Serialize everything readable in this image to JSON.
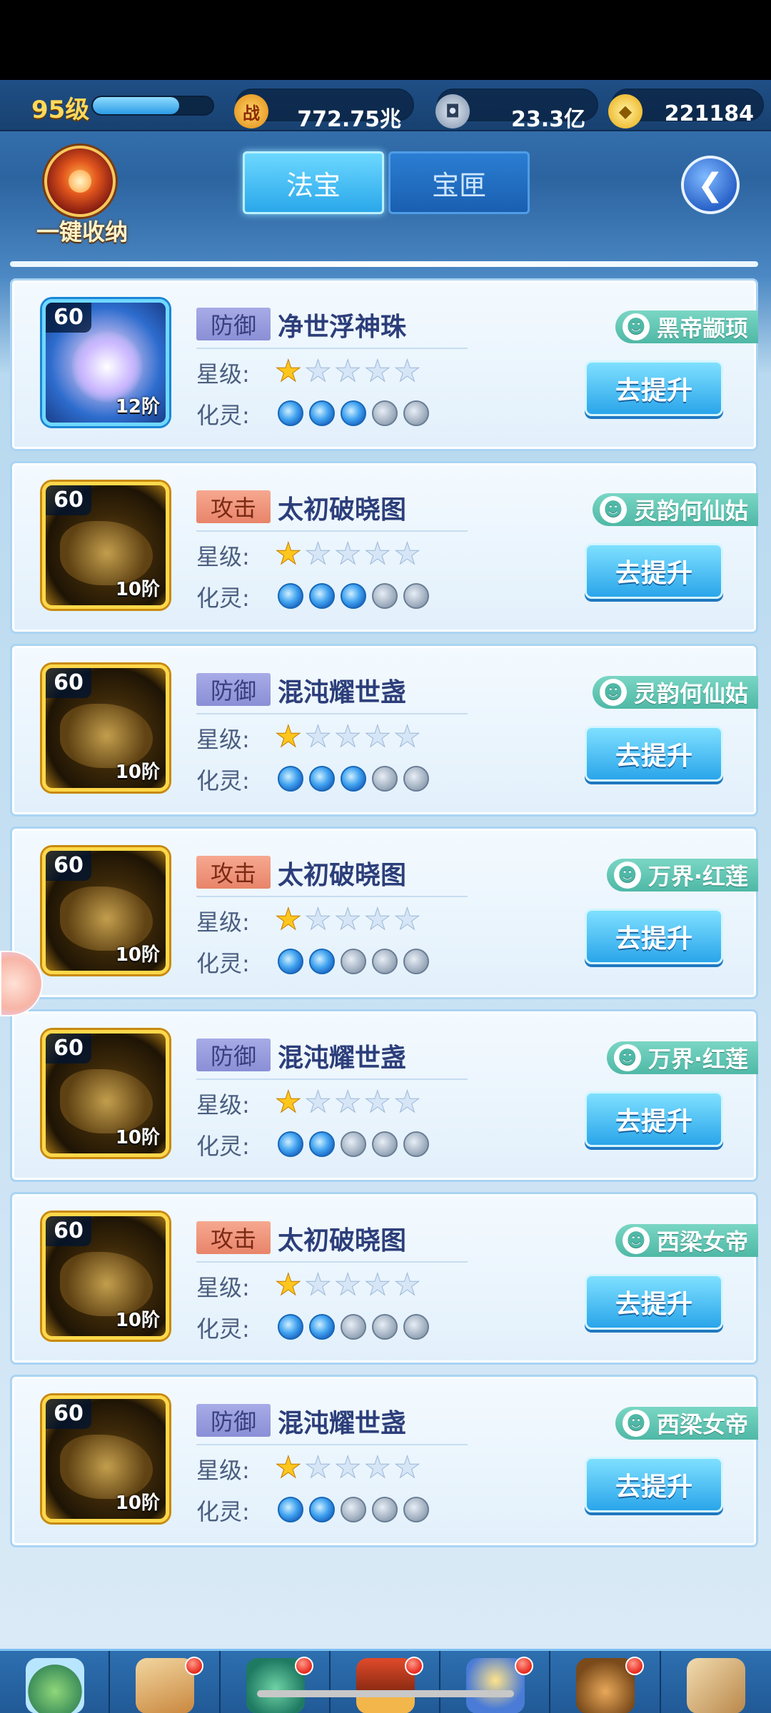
{
  "top": {
    "level": "95级",
    "exp_fraction": 0.72,
    "power": "772.75兆",
    "coins": "23.3亿",
    "gold": "221184"
  },
  "header": {
    "collect_label": "一键收纳",
    "tabs": [
      "法宝",
      "宝匣"
    ],
    "active_tab": "法宝"
  },
  "labels": {
    "star": "星级:",
    "spirit": "化灵:",
    "upgrade": "去提升"
  },
  "items": [
    {
      "level": "60",
      "rank": "12阶",
      "type": "防御",
      "name": "净世浮神珠",
      "stars": 1,
      "spirit": 3,
      "owner": "黑帝颛顼",
      "frame": "blue"
    },
    {
      "level": "60",
      "rank": "10阶",
      "type": "攻击",
      "name": "太初破晓图",
      "stars": 1,
      "spirit": 3,
      "owner": "灵韵何仙姑",
      "frame": "gold"
    },
    {
      "level": "60",
      "rank": "10阶",
      "type": "防御",
      "name": "混沌耀世盏",
      "stars": 1,
      "spirit": 3,
      "owner": "灵韵何仙姑",
      "frame": "gold"
    },
    {
      "level": "60",
      "rank": "10阶",
      "type": "攻击",
      "name": "太初破晓图",
      "stars": 1,
      "spirit": 2,
      "owner": "万界·红莲",
      "frame": "gold"
    },
    {
      "level": "60",
      "rank": "10阶",
      "type": "防御",
      "name": "混沌耀世盏",
      "stars": 1,
      "spirit": 2,
      "owner": "万界·红莲",
      "frame": "gold"
    },
    {
      "level": "60",
      "rank": "10阶",
      "type": "攻击",
      "name": "太初破晓图",
      "stars": 1,
      "spirit": 2,
      "owner": "西梁女帝",
      "frame": "gold"
    },
    {
      "level": "60",
      "rank": "10阶",
      "type": "防御",
      "name": "混沌耀世盏",
      "stars": 1,
      "spirit": 2,
      "owner": "西梁女帝",
      "frame": "gold"
    }
  ],
  "nav": [
    {
      "label": "首页",
      "dot": false,
      "icon": "home-island-icon"
    },
    {
      "label": "阵容",
      "dot": true,
      "icon": "lineup-cards-icon"
    },
    {
      "label": "历练",
      "dot": true,
      "icon": "training-creature-icon"
    },
    {
      "label": "副本",
      "dot": true,
      "icon": "dungeon-gate-icon"
    },
    {
      "label": "斗法",
      "dot": true,
      "icon": "battle-swords-icon"
    },
    {
      "label": "背包",
      "dot": true,
      "icon": "backpack-icon"
    },
    {
      "label": "寻仙",
      "dot": false,
      "icon": "scroll-icon"
    }
  ],
  "colors": {
    "defense_badge": "#8a8fd6",
    "attack_badge": "#e8846a",
    "owner_tag": "#4fb8a6",
    "upgrade_button": "#2aa5ea"
  }
}
